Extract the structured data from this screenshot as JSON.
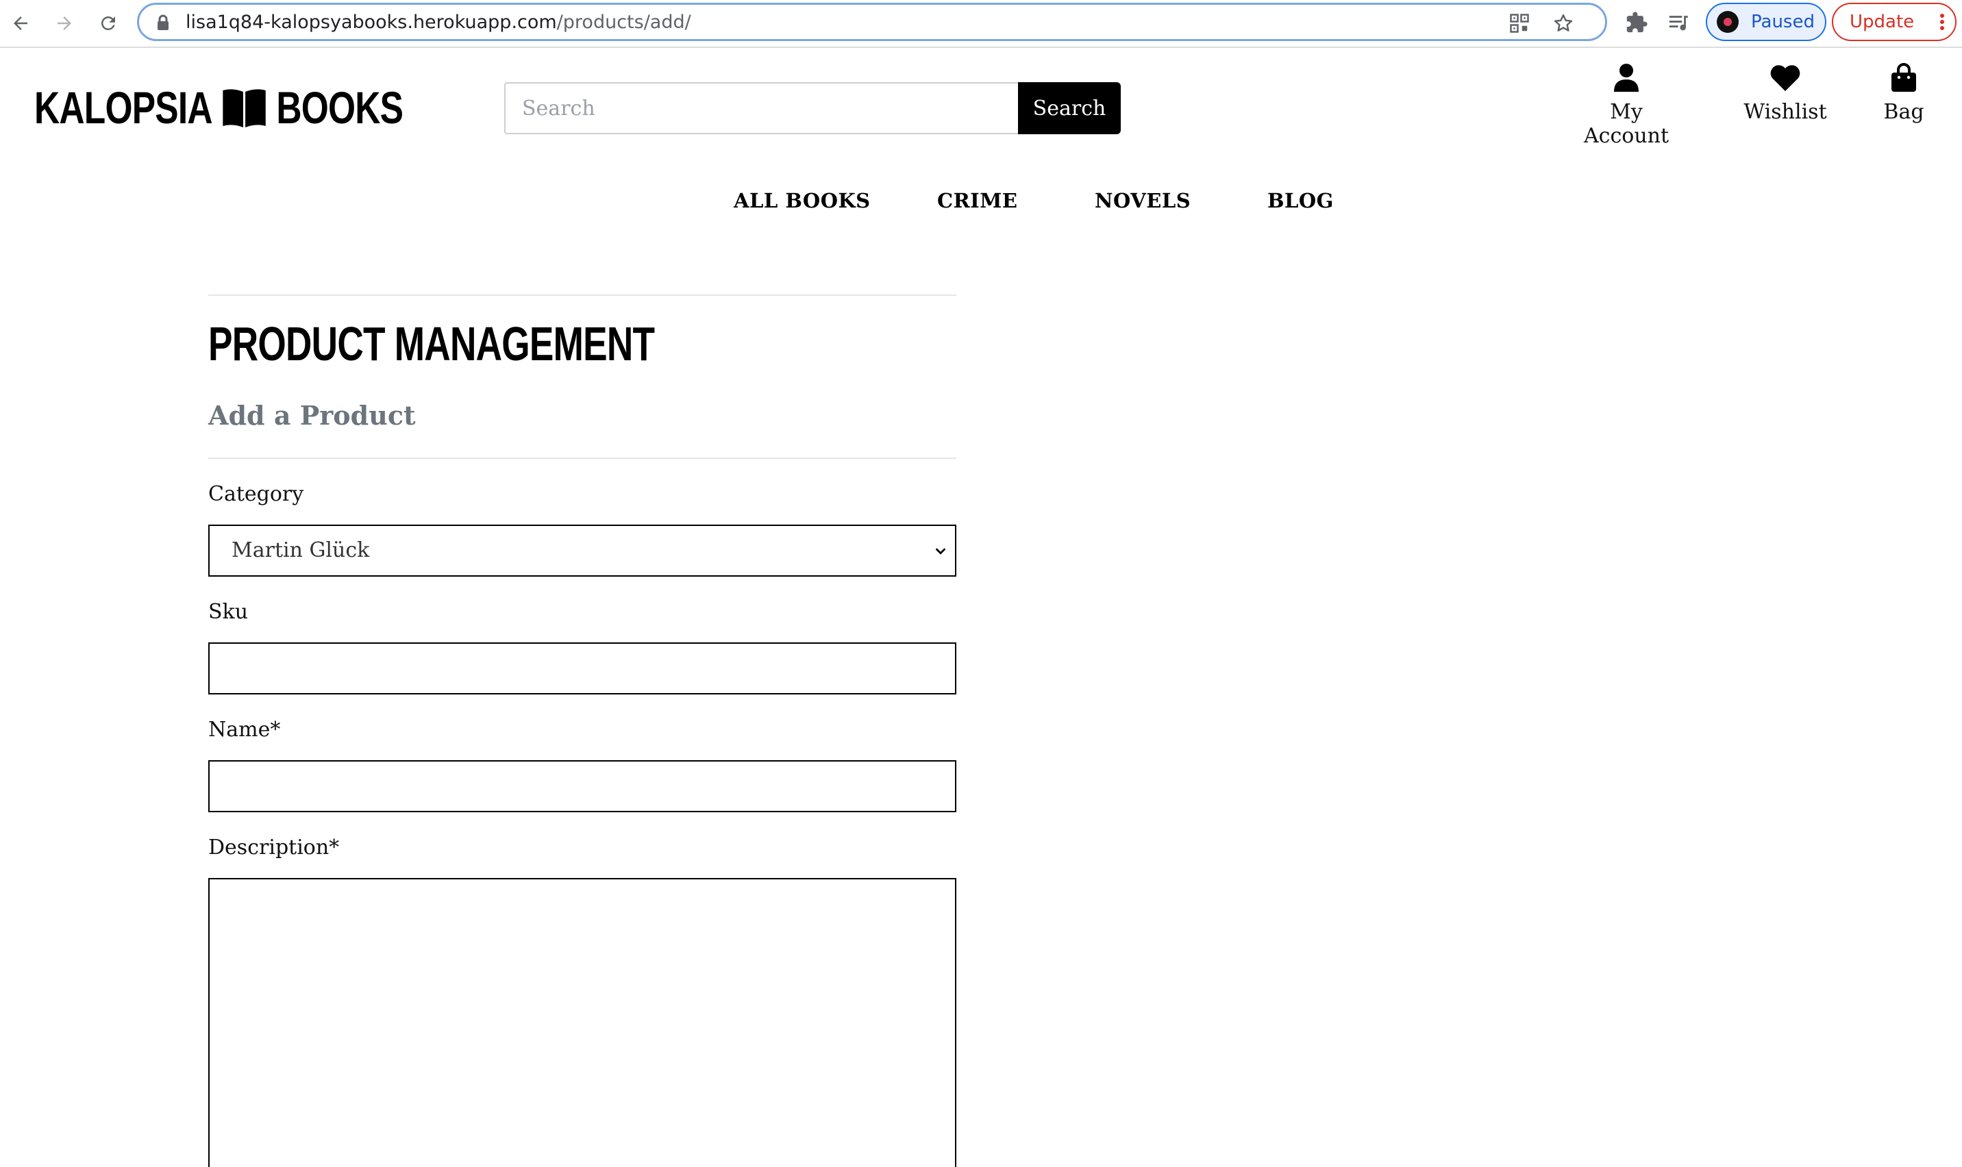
{
  "browser": {
    "url_host": "lisa1q84-kalopsyabooks.herokuapp.com",
    "url_path": "/products/add/",
    "paused_label": "Paused",
    "update_label": "Update"
  },
  "header": {
    "logo_left": "KALOPSIA",
    "logo_right": "BOOKS",
    "search_placeholder": "Search",
    "search_button": "Search",
    "links": {
      "account": "My Account",
      "wishlist": "Wishlist",
      "bag": "Bag"
    }
  },
  "nav": {
    "all_books": "ALL BOOKS",
    "crime": "CRIME",
    "novels": "NOVELS",
    "blog": "BLOG"
  },
  "page": {
    "title": "PRODUCT MANAGEMENT",
    "subtitle": "Add a Product"
  },
  "form": {
    "category_label": "Category",
    "category_value": "Martin Glück",
    "sku_label": "Sku",
    "sku_value": "",
    "name_label": "Name*",
    "name_value": "",
    "description_label": "Description*",
    "description_value": ""
  }
}
